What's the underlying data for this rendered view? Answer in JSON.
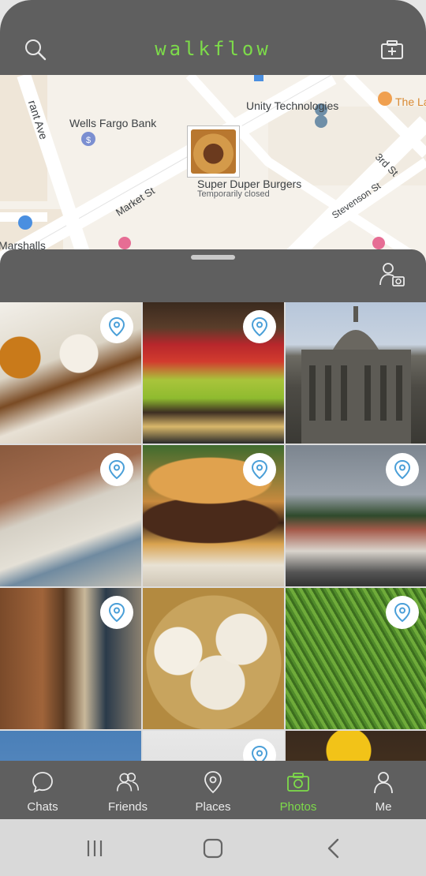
{
  "header": {
    "brand": "walkflow",
    "search_icon": "search-icon",
    "add_photo_icon": "add-photo-icon"
  },
  "map": {
    "labels": {
      "street_grant": "rant Ave",
      "wells_fargo": "Wells Fargo Bank",
      "unity": "Unity Technologies",
      "the_la": "The La",
      "market_st": "Market St",
      "third_st": "3rd St",
      "stevenson_st": "Stevenson St",
      "marshalls": "Marshalls",
      "super_duper": "Super Duper Burgers",
      "super_duper_status": "Temporarily closed"
    }
  },
  "sheet": {
    "handle_icon": "drag-handle",
    "person_camera_icon": "person-camera-icon"
  },
  "photos": [
    {
      "subject": "french-toast",
      "has_pin": true
    },
    {
      "subject": "produce-market",
      "has_pin": true
    },
    {
      "subject": "city-hall",
      "has_pin": false
    },
    {
      "subject": "brick-building",
      "has_pin": true
    },
    {
      "subject": "burger",
      "has_pin": true
    },
    {
      "subject": "victorian-houses",
      "has_pin": true
    },
    {
      "subject": "tree-sculpture",
      "has_pin": true
    },
    {
      "subject": "dumplings",
      "has_pin": false
    },
    {
      "subject": "green-plants",
      "has_pin": true
    },
    {
      "subject": "sky",
      "has_pin": false
    },
    {
      "subject": "partial",
      "has_pin": true
    },
    {
      "subject": "yellow-flower",
      "has_pin": false
    }
  ],
  "tabs": [
    {
      "label": "Chats",
      "icon": "chat-icon",
      "active": false
    },
    {
      "label": "Friends",
      "icon": "friends-icon",
      "active": false
    },
    {
      "label": "Places",
      "icon": "place-pin-icon",
      "active": false
    },
    {
      "label": "Photos",
      "icon": "camera-icon",
      "active": true
    },
    {
      "label": "Me",
      "icon": "person-icon",
      "active": false
    }
  ],
  "colors": {
    "accent": "#7ddb4a",
    "bar": "#5f5f5f",
    "pin": "#4a9fd8"
  }
}
